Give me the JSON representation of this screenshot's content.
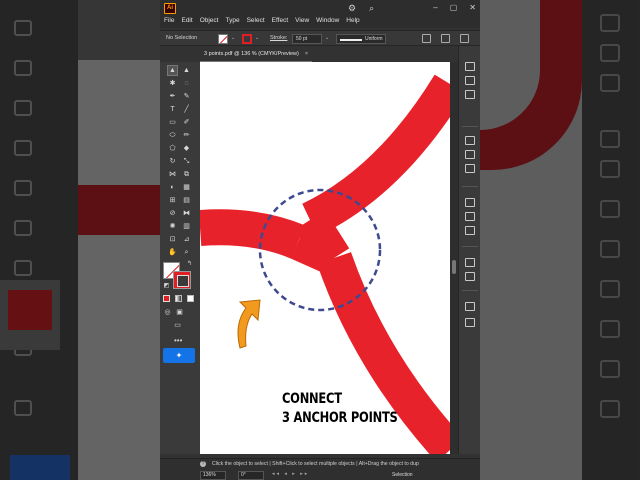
{
  "app": {
    "logo_text": "Ai",
    "menu": [
      "File",
      "Edit",
      "Object",
      "Type",
      "Select",
      "Effect",
      "View",
      "Window",
      "Help"
    ]
  },
  "control_bar": {
    "selection": "No Selection",
    "stroke_label": "Stroke:",
    "stroke_weight": "50 pt",
    "profile": "Uniform",
    "fill_color": "#ffffff",
    "stroke_color": "#e01e26"
  },
  "document_tab": {
    "title": "3 points.pdf @ 136 % (CMYK/Preview)",
    "close": "×"
  },
  "canvas": {
    "caption_line1": "CONNECT",
    "caption_line2": "3 ANCHOR POINTS",
    "stroke_color": "#e8222a",
    "circle_color": "#3d4a8f",
    "arrow_color": "#f29a1e"
  },
  "status_bar": {
    "hint": "Click the object to select | Shift+Click to select multiple objects | Alt+Drag the object to dup",
    "zoom": "136%",
    "rotation": "0°",
    "tool": "Selection"
  }
}
